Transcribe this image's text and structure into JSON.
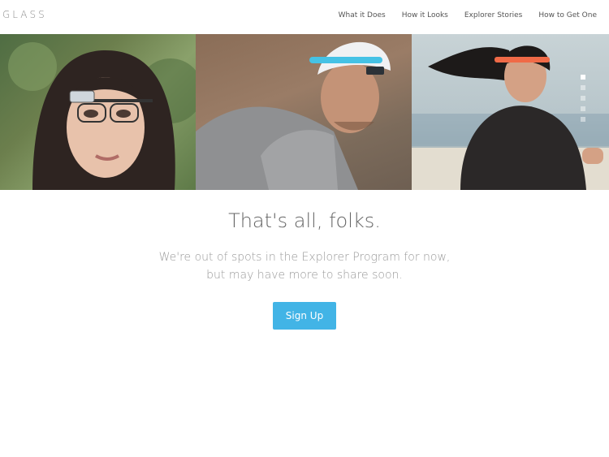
{
  "brand": {
    "logo_text": "GLASS"
  },
  "nav": {
    "items": [
      {
        "label": "What it Does"
      },
      {
        "label": "How it Looks"
      },
      {
        "label": "Explorer Stories"
      },
      {
        "label": "How to Get One"
      }
    ]
  },
  "hero": {
    "panels": [
      "woman-with-glass-frames-photo",
      "cyclist-with-blue-glass-photo",
      "runner-with-orange-glass-photo"
    ],
    "carousel": {
      "slide_count": 5,
      "active_index": 0
    }
  },
  "main": {
    "headline": "That's all, folks.",
    "subtext": "We're out of spots in the Explorer Program for now, but may have more to share soon.",
    "cta_label": "Sign Up"
  },
  "colors": {
    "accent": "#42b4e6",
    "nav_text": "#555555",
    "headline": "#666666",
    "subtext": "#9a9a9a"
  }
}
